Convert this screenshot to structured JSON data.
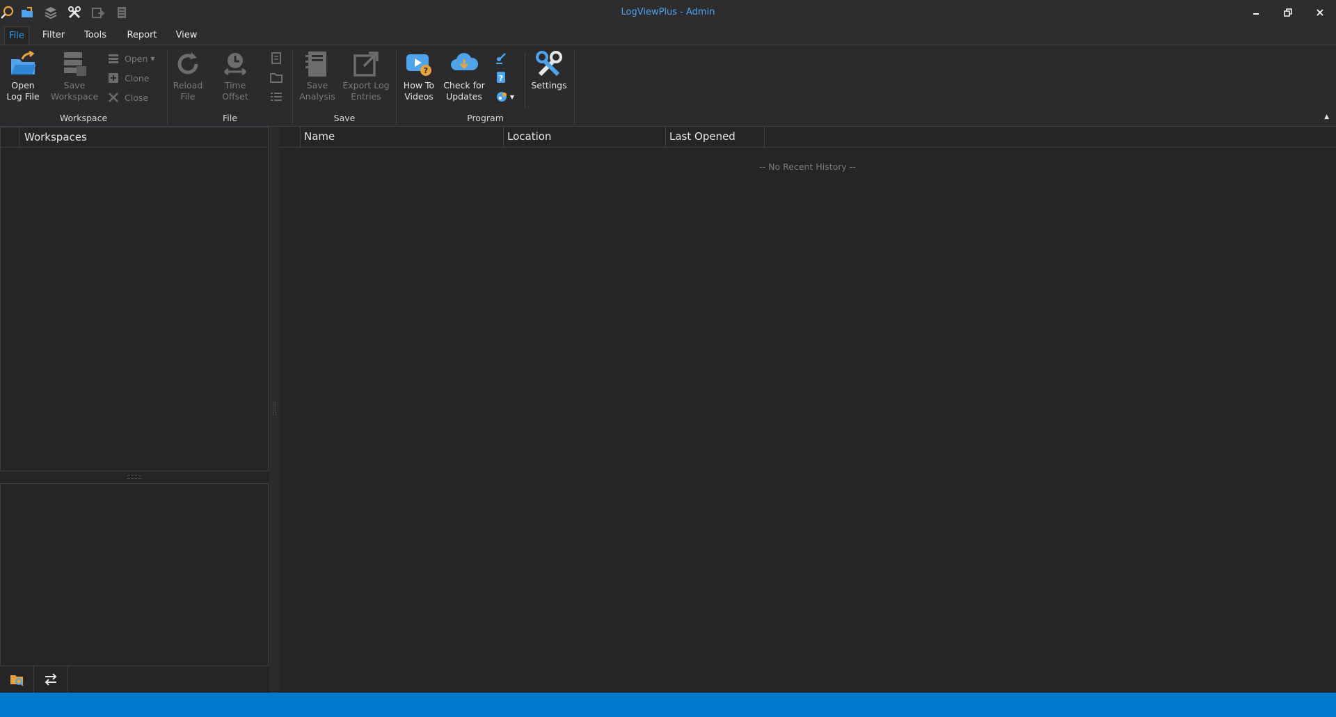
{
  "window": {
    "title": "LogViewPlus - Admin",
    "controls": [
      "minimize-icon",
      "restore-icon",
      "close-icon"
    ]
  },
  "quick_access": [
    "search-icon",
    "open-folder-icon",
    "layers-icon",
    "tools-icon",
    "export-icon",
    "document-icon"
  ],
  "menu": {
    "tabs": [
      {
        "label": "File",
        "active": true
      },
      {
        "label": "Filter"
      },
      {
        "label": "Tools"
      },
      {
        "label": "Report"
      },
      {
        "label": "View"
      }
    ]
  },
  "ribbon": {
    "groups": {
      "workspace": "Workspace",
      "file": "File",
      "save": "Save",
      "program": "Program"
    },
    "open_log_file": "Open\nLog File",
    "save_workspace": "Save\nWorkspace",
    "open": "Open",
    "clone": "Clone",
    "close": "Close",
    "reload_file": "Reload\nFile",
    "time_offset": "Time Offset",
    "save_analysis": "Save\nAnalysis",
    "export_log_entries": "Export Log\nEntries",
    "how_to_videos": "How To\nVideos",
    "check_for_updates": "Check for\nUpdates",
    "settings": "Settings"
  },
  "workspaces": {
    "header": "Workspaces"
  },
  "recent": {
    "columns": [
      "Name",
      "Location",
      "Last Opened"
    ],
    "empty_message": "-- No Recent History --"
  },
  "colors": {
    "accent": "#007acc",
    "title_text": "#4ea3ea",
    "background": "#252526"
  }
}
